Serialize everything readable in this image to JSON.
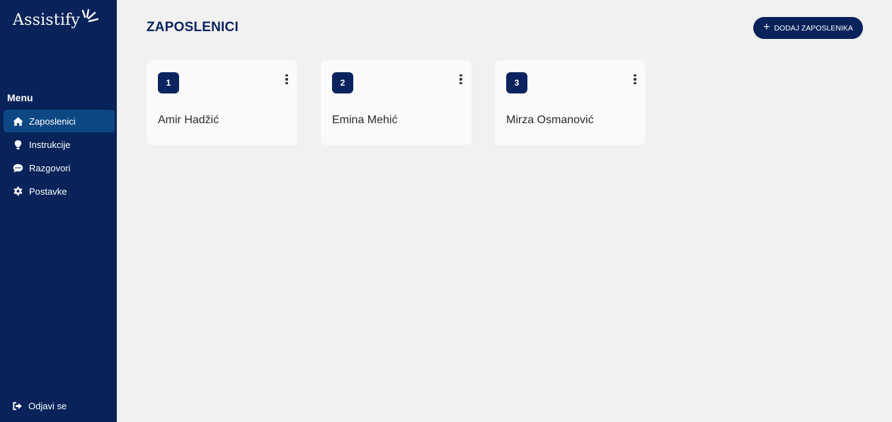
{
  "sidebar": {
    "logo_text": "Assistify",
    "menu_heading": "Menu",
    "items": [
      {
        "label": "Zaposlenici",
        "icon": "home-icon",
        "active": true
      },
      {
        "label": "Instrukcije",
        "icon": "lightbulb-icon",
        "active": false
      },
      {
        "label": "Razgovori",
        "icon": "chat-icon",
        "active": false
      },
      {
        "label": "Postavke",
        "icon": "gear-icon",
        "active": false
      }
    ],
    "logout_label": "Odjavi se",
    "logout_icon": "logout-icon"
  },
  "main": {
    "title": "ZAPOSLENICI",
    "add_button_label": "DODAJ ZAPOSLENIKA",
    "add_button_icon": "plus-icon",
    "employees": [
      {
        "number": "1",
        "name": "Amir Hadžić"
      },
      {
        "number": "2",
        "name": "Emina Mehić"
      },
      {
        "number": "3",
        "name": "Mirza Osmanović"
      }
    ]
  },
  "colors": {
    "sidebar_bg": "#08235a",
    "active_item_bg": "#0d4884",
    "page_bg": "#f1f1f1",
    "card_bg": "#fafafa",
    "accent": "#0b2460"
  }
}
